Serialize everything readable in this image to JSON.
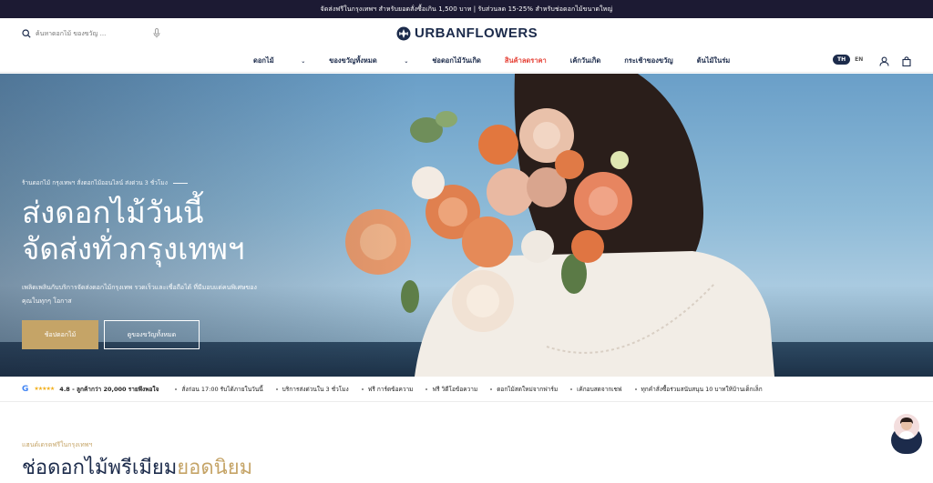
{
  "announcement": "จัดส่งฟรีในกรุงเทพฯ สำหรับยอดสั่งซื้อเกิน 1,500 บาท | รับส่วนลด 15-25% สำหรับช่อดอกไม้ขนาดใหญ่",
  "search": {
    "placeholder": "ค้นหาดอกไม้ ของขวัญ ..."
  },
  "logo": {
    "text": "URBANFLOWERS"
  },
  "nav": {
    "items": [
      {
        "label": "ดอกไม้",
        "chevron": true
      },
      {
        "label": "ของขวัญทั้งหมด",
        "chevron": true
      },
      {
        "label": "ช่อดอกไม้วันเกิด",
        "chevron": false
      },
      {
        "label": "สินค้าลดราคา",
        "chevron": false,
        "highlight": "#e6453a"
      },
      {
        "label": "เค้กวันเกิด",
        "chevron": false
      },
      {
        "label": "กระเช้าของขวัญ",
        "chevron": false
      },
      {
        "label": "ต้นไม้ในร่ม",
        "chevron": false
      }
    ],
    "lang_th": "TH",
    "lang_en": "EN"
  },
  "hero": {
    "subtitle": "ร้านดอกไม้ กรุงเทพฯ สั่งดอกไม้ออนไลน์ ส่งด่วน 3 ชั่วโมง",
    "title_line1": "ส่งดอกไม้วันนี้",
    "title_line2": "จัดส่งทั่วกรุงเทพฯ",
    "desc_line1": "เพลิดเพลินกับบริการจัดส่งดอกไม้กรุงเทพ รวดเร็วและเชื่อถือได้ ที่มีมอบแด่คนพิเศษของ",
    "desc_line2": "คุณในทุกๆ โอกาส",
    "primary_button": "ช้อปดอกไม้",
    "secondary_button": "ดูของขวัญทั้งหมด"
  },
  "trust": {
    "google_letter": "G",
    "stars": "★★★★★",
    "rating": "4.8 - ลูกค้ากว่า 20,000 รายพึงพอใจ",
    "features": [
      "สั่งก่อน 17:00 รับได้ภายในวันนี้",
      "บริการส่งด่วนใน 3 ชั่วโมง",
      "ฟรี การ์ดข้อความ",
      "ฟรี วิดีโอข้อความ",
      "ดอกไม้สดใหม่จากฟาร์ม",
      "เค้กอบสดจากเชฟ",
      "ทุกคำสั่งซื้อร่วมสนับสนุน 10 บาทให้บ้านเด็กเล็ก"
    ]
  },
  "section": {
    "label": "แฮนด์เดรดฟรีในกรุงเทพฯ",
    "title_main": "ช่อดอกไม้พรีเมียม",
    "title_accent": "ยอดนิยม"
  },
  "colors": {
    "navy": "#1c2b4b",
    "gold": "#c5a467",
    "sale": "#e6453a",
    "announce_bg": "#1c1a33"
  }
}
